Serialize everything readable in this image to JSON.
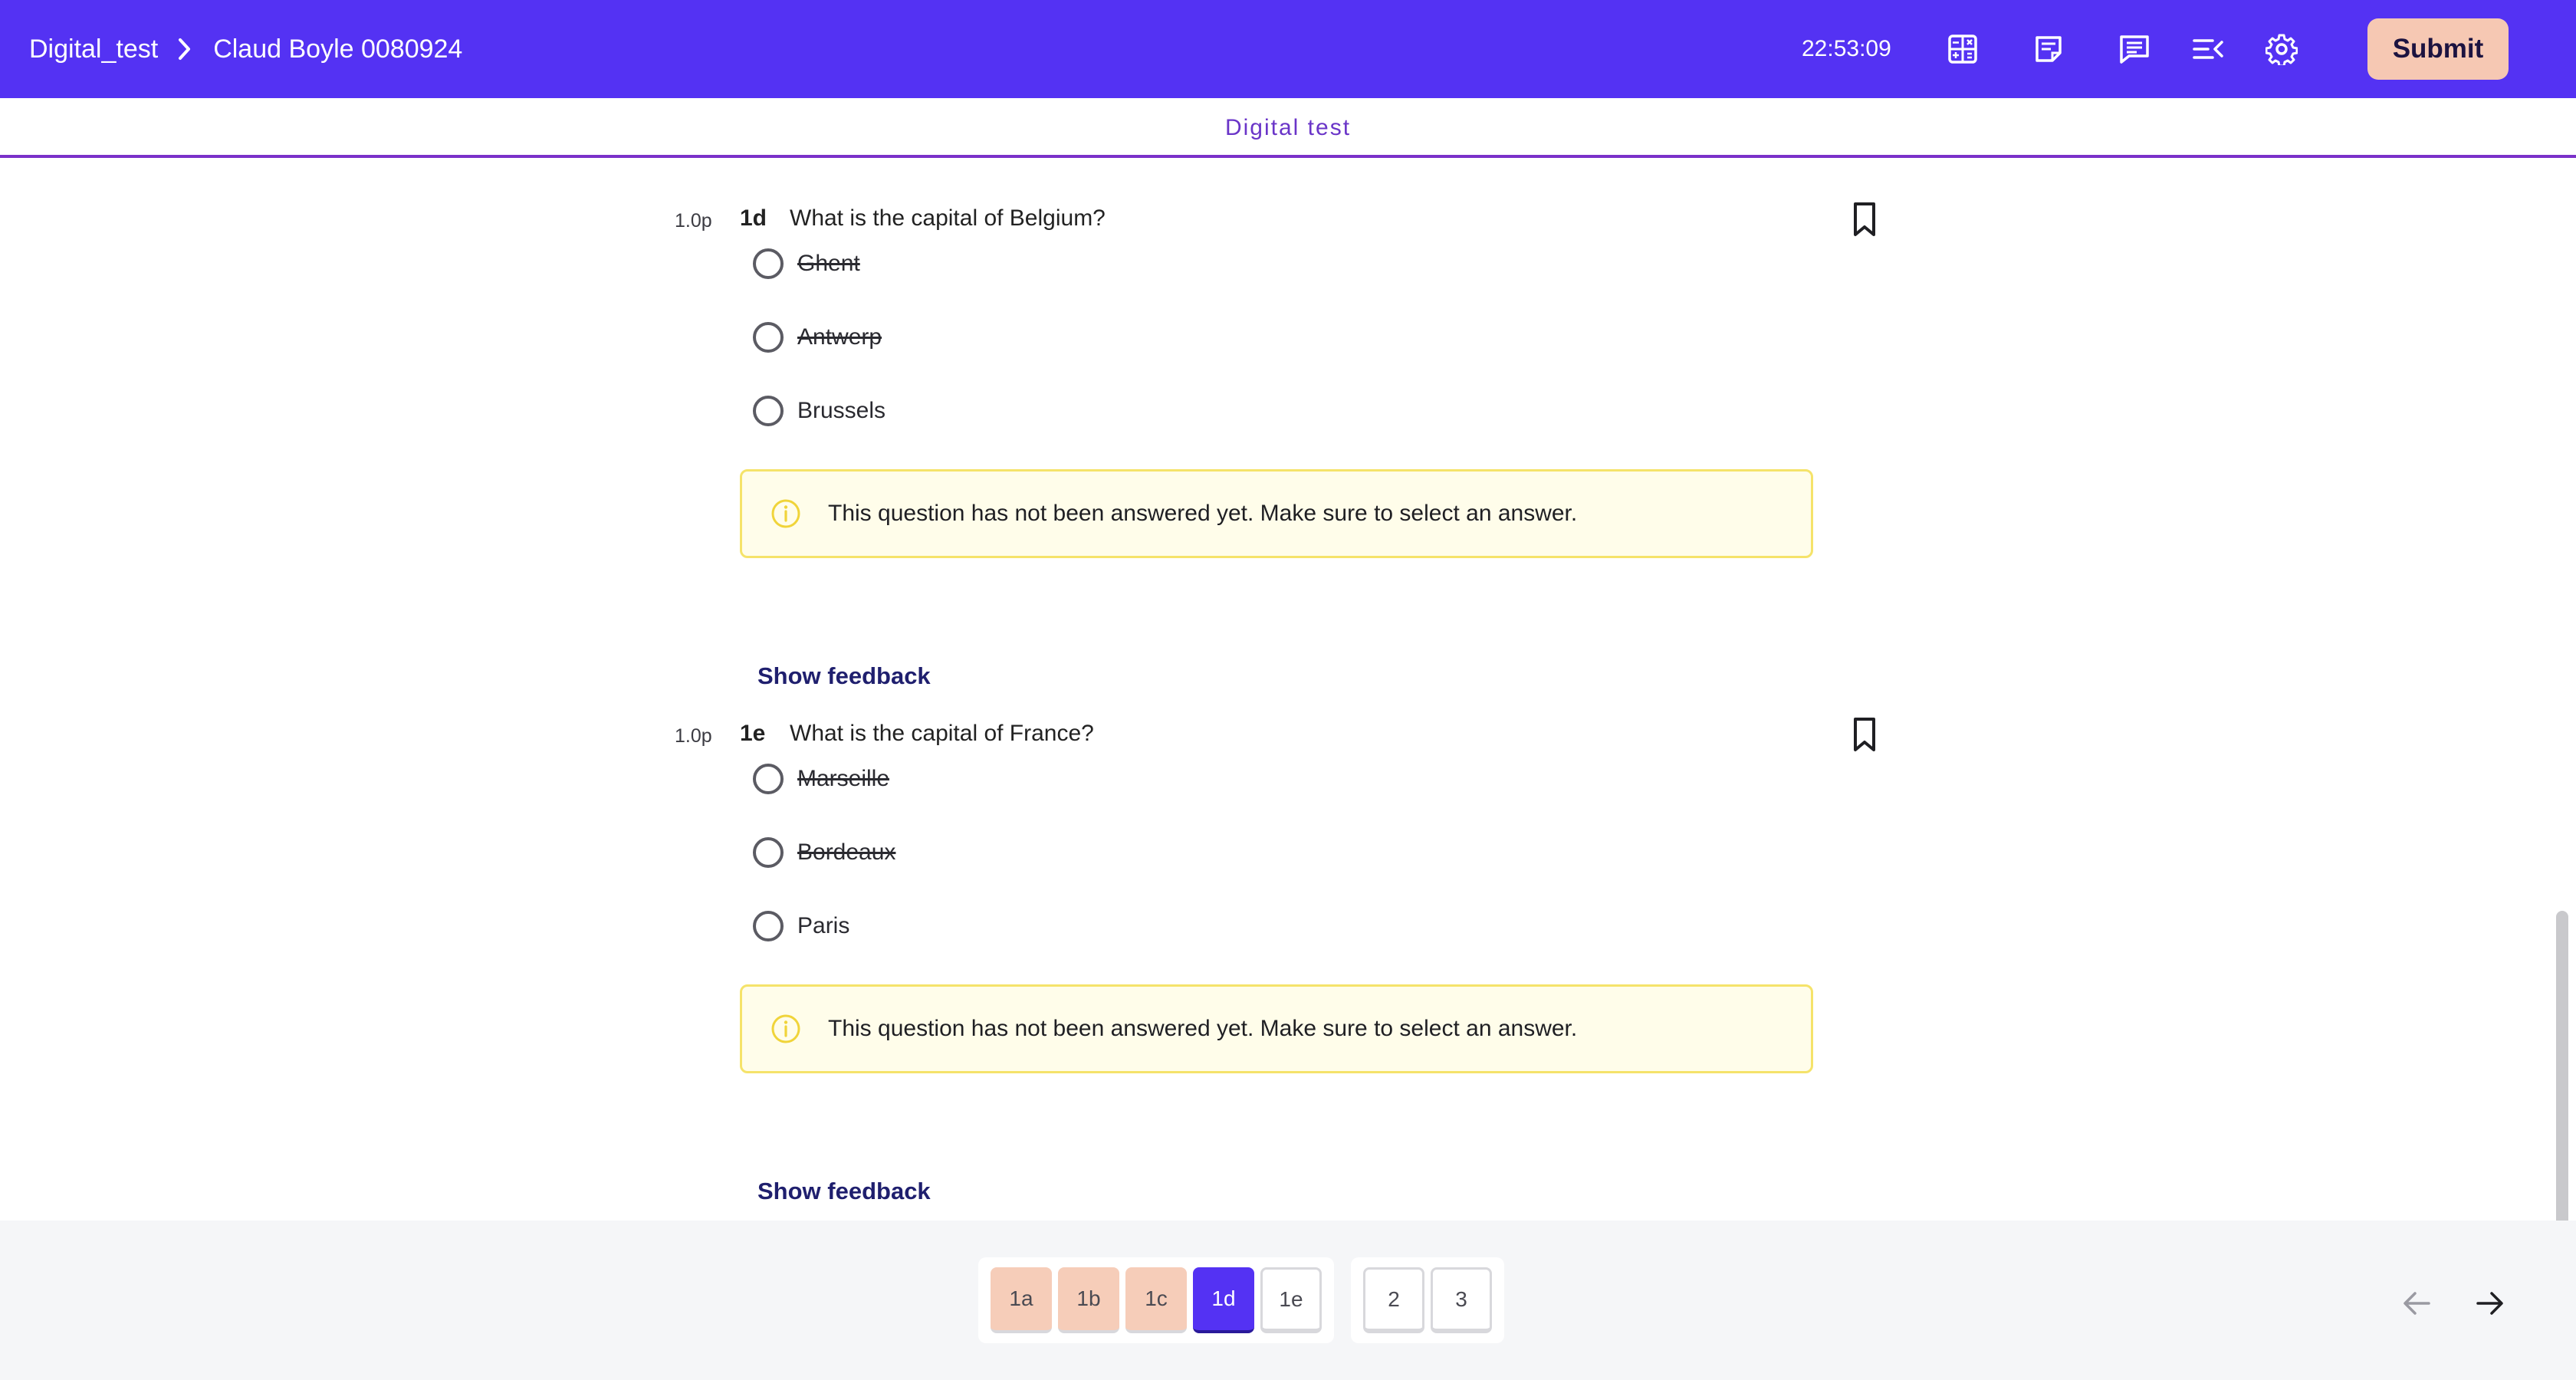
{
  "header": {
    "breadcrumb_root": "Digital_test",
    "breadcrumb_current": "Claud Boyle 0080924",
    "clock": "22:53:09",
    "submit_label": "Submit",
    "icons": [
      "calculator-icon",
      "notes-icon",
      "chat-icon",
      "collapse-menu-icon",
      "gear-icon"
    ]
  },
  "subheader": {
    "title": "Digital test"
  },
  "questions": [
    {
      "points": "1.0p",
      "number": "1d",
      "text": "What is the capital of Belgium?",
      "options": [
        {
          "label": "Ghent",
          "struck": true
        },
        {
          "label": "Antwerp",
          "struck": true
        },
        {
          "label": "Brussels",
          "struck": false
        }
      ],
      "warning": "This question has not been answered yet. Make sure to select an answer.",
      "feedback_label": "Show feedback"
    },
    {
      "points": "1.0p",
      "number": "1e",
      "text": "What is the capital of France?",
      "options": [
        {
          "label": "Marseille",
          "struck": true
        },
        {
          "label": "Bordeaux",
          "struck": true
        },
        {
          "label": "Paris",
          "struck": false
        }
      ],
      "warning": "This question has not been answered yet. Make sure to select an answer.",
      "feedback_label": "Show feedback"
    }
  ],
  "pager": {
    "group1": [
      {
        "label": "1a",
        "state": "answered"
      },
      {
        "label": "1b",
        "state": "answered"
      },
      {
        "label": "1c",
        "state": "answered"
      },
      {
        "label": "1d",
        "state": "current"
      },
      {
        "label": "1e",
        "state": "open"
      }
    ],
    "group2": [
      {
        "label": "2",
        "state": "open"
      },
      {
        "label": "3",
        "state": "open"
      }
    ]
  },
  "colors": {
    "brand": "#5432f3",
    "submit_bg": "#f6c8b3",
    "answered": "#f6cdb9",
    "warning_bg": "#fffdea",
    "warning_border": "#f5e36a"
  }
}
